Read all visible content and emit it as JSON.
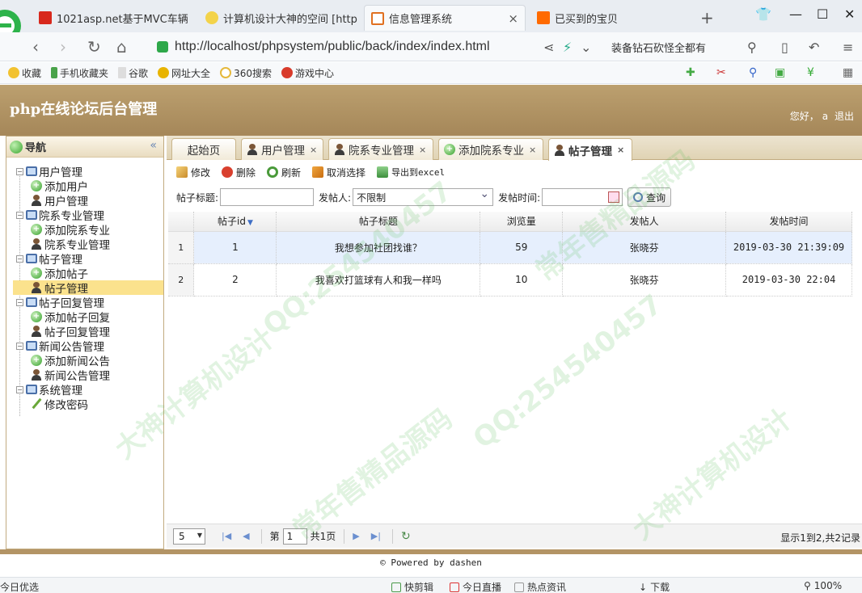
{
  "browser": {
    "tabs": [
      {
        "title": "1021asp.net基于MVC车辆",
        "icon_color": "#d8281c"
      },
      {
        "title": "计算机设计大神的空间 [http",
        "icon_color": "#e6b800"
      },
      {
        "title": "信息管理系统",
        "icon_color": "#e07020",
        "active": true
      },
      {
        "title": "已买到的宝贝",
        "icon_color": "#ff6a00"
      }
    ],
    "url": "http://localhost/phpsystem/public/back/index/index.html",
    "search_text": "装备钻石砍怪全都有",
    "bookmarks": [
      "收藏",
      "手机收藏夹",
      "谷歌",
      "网址大全",
      "360搜索",
      "游戏中心"
    ]
  },
  "app": {
    "title": "php在线论坛后台管理",
    "greeting": "您好，",
    "username": "a",
    "logout": "退出"
  },
  "nav": {
    "title": "导航",
    "tree": [
      {
        "label": "用户管理",
        "children": [
          {
            "label": "添加用户",
            "icon": "add-icon"
          },
          {
            "label": "用户管理",
            "icon": "user-icon"
          }
        ]
      },
      {
        "label": "院系专业管理",
        "children": [
          {
            "label": "添加院系专业",
            "icon": "add-icon"
          },
          {
            "label": "院系专业管理",
            "icon": "user-icon"
          }
        ]
      },
      {
        "label": "帖子管理",
        "children": [
          {
            "label": "添加帖子",
            "icon": "add-icon"
          },
          {
            "label": "帖子管理",
            "icon": "user-icon",
            "selected": true
          }
        ]
      },
      {
        "label": "帖子回复管理",
        "children": [
          {
            "label": "添加帖子回复",
            "icon": "add-icon"
          },
          {
            "label": "帖子回复管理",
            "icon": "user-icon"
          }
        ]
      },
      {
        "label": "新闻公告管理",
        "children": [
          {
            "label": "添加新闻公告",
            "icon": "add-icon"
          },
          {
            "label": "新闻公告管理",
            "icon": "user-icon"
          }
        ]
      },
      {
        "label": "系统管理",
        "children": [
          {
            "label": "修改密码",
            "icon": "pen-icon"
          }
        ]
      }
    ]
  },
  "tabs": [
    {
      "label": "起始页",
      "closable": false
    },
    {
      "label": "用户管理",
      "closable": true
    },
    {
      "label": "院系专业管理",
      "closable": true
    },
    {
      "label": "添加院系专业",
      "closable": true
    },
    {
      "label": "帖子管理",
      "closable": true,
      "active": true
    }
  ],
  "toolbar": {
    "edit": "修改",
    "delete": "删除",
    "refresh": "刷新",
    "cancel_select": "取消选择",
    "export": "导出到excel"
  },
  "search": {
    "title_label": "帖子标题:",
    "title_value": "",
    "poster_label": "发帖人:",
    "poster_value": "不限制",
    "time_label": "发帖时间:",
    "time_value": "",
    "query_button": "查询"
  },
  "grid": {
    "columns": [
      "帖子id",
      "帖子标题",
      "浏览量",
      "发帖人",
      "发帖时间"
    ],
    "rows": [
      {
        "rownum": "1",
        "id": "1",
        "title": "我想参加社团找谁？",
        "views": "59",
        "poster": "张晓芬",
        "time": "2019-03-30 21:39:09"
      },
      {
        "rownum": "2",
        "id": "2",
        "title": "我喜欢打篮球有人和我一样吗",
        "views": "10",
        "poster": "张晓芬",
        "time": "2019-03-30 22:04"
      }
    ]
  },
  "pager": {
    "page_size": "5",
    "page_prefix": "第",
    "page_value": "1",
    "page_total": "共1页",
    "info": "显示1到2,共2记录"
  },
  "footer": "© Powered by dashen",
  "statusbar": {
    "left": "今日优选",
    "items": [
      "快剪辑",
      "今日直播",
      "热点资讯",
      "下载",
      "100%"
    ]
  },
  "watermarks": [
    "QQ:254540457",
    "大神计算机设计",
    "常年售精品源码"
  ]
}
